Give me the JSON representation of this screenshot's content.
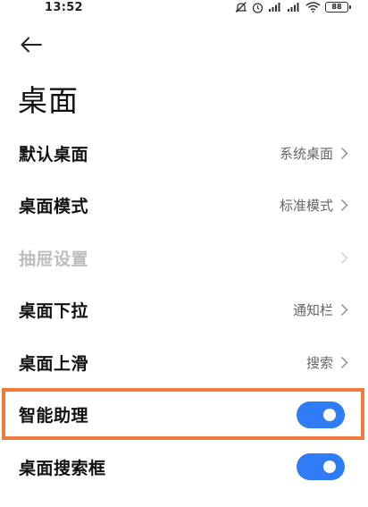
{
  "status_bar": {
    "time": "13:52",
    "battery": "88",
    "icons": [
      "alarm-off-icon",
      "clock-icon",
      "signal-icon",
      "signal-icon",
      "wifi-icon",
      "battery-icon"
    ]
  },
  "header": {
    "back_icon": "arrow-left-icon",
    "title": "桌面"
  },
  "settings": [
    {
      "id": "default-desktop",
      "label": "默认桌面",
      "value": "系统桌面",
      "control": "chevron",
      "enabled": true
    },
    {
      "id": "desktop-mode",
      "label": "桌面模式",
      "value": "标准模式",
      "control": "chevron",
      "enabled": true
    },
    {
      "id": "drawer-settings",
      "label": "抽屉设置",
      "value": "",
      "control": "chevron",
      "enabled": false
    },
    {
      "id": "pull-down",
      "label": "桌面下拉",
      "value": "通知栏",
      "control": "chevron",
      "enabled": true
    },
    {
      "id": "swipe-up",
      "label": "桌面上滑",
      "value": "搜索",
      "control": "chevron",
      "enabled": true
    },
    {
      "id": "smart-assistant",
      "label": "智能助理",
      "control": "toggle",
      "on": true,
      "enabled": true,
      "highlighted": true
    },
    {
      "id": "search-box",
      "label": "桌面搜索框",
      "control": "toggle",
      "on": true,
      "enabled": true
    }
  ],
  "colors": {
    "toggle_on": "#2f7cf6",
    "highlight": "#ef7a3e",
    "disabled_text": "#bdbdbd",
    "value_text": "#666666"
  }
}
